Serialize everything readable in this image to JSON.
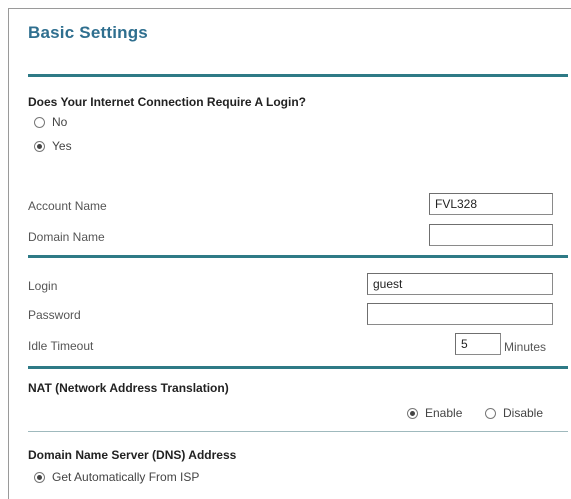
{
  "page": {
    "title": "Basic Settings"
  },
  "login_section": {
    "question": "Does Your Internet Connection Require A Login?",
    "options": [
      {
        "label": "No",
        "selected": false
      },
      {
        "label": "Yes",
        "selected": true
      }
    ]
  },
  "account": {
    "account_name_label": "Account Name",
    "account_name_value": "FVL328",
    "domain_name_label": "Domain Name",
    "domain_name_value": ""
  },
  "credentials": {
    "login_label": "Login",
    "login_value": "guest",
    "password_label": "Password",
    "password_value": "",
    "idle_timeout_label": "Idle Timeout",
    "idle_timeout_value": "5",
    "idle_timeout_units": "Minutes"
  },
  "nat": {
    "heading": "NAT (Network Address Translation)",
    "options": [
      {
        "label": "Enable",
        "selected": true
      },
      {
        "label": "Disable",
        "selected": false
      }
    ]
  },
  "dns": {
    "heading": "Domain Name Server (DNS) Address",
    "option_label": "Get Automatically From ISP",
    "option_selected": true
  },
  "colors": {
    "accent": "#2e7a86",
    "title": "#2f6f8f"
  }
}
